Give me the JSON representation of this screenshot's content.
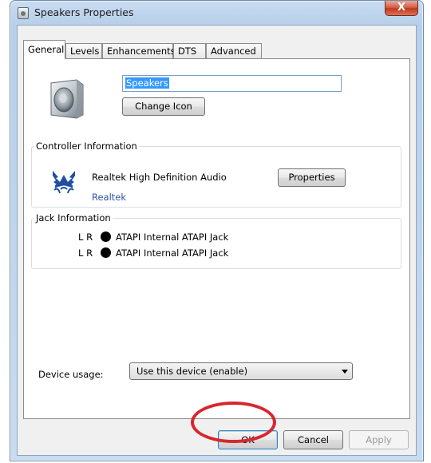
{
  "window": {
    "title": "Speakers Properties",
    "close_label": "X"
  },
  "tabs": [
    {
      "label": "General",
      "active": true
    },
    {
      "label": "Levels",
      "active": false
    },
    {
      "label": "Enhancements",
      "active": false
    },
    {
      "label": "DTS",
      "active": false
    },
    {
      "label": "Advanced",
      "active": false
    }
  ],
  "general": {
    "device_name": "Speakers",
    "change_icon_label": "Change Icon"
  },
  "controller": {
    "group_label": "Controller Information",
    "name": "Realtek High Definition Audio",
    "vendor_link": "Realtek",
    "properties_label": "Properties"
  },
  "jack": {
    "group_label": "Jack Information",
    "rows": [
      {
        "channels": "L R",
        "name": "ATAPI Internal ATAPI Jack"
      },
      {
        "channels": "L R",
        "name": "ATAPI Internal ATAPI Jack"
      }
    ]
  },
  "device_usage": {
    "label": "Device usage:",
    "selected": "Use this device (enable)"
  },
  "footer": {
    "ok_label": "OK",
    "cancel_label": "Cancel",
    "apply_label": "Apply",
    "apply_enabled": false
  },
  "colors": {
    "highlight_ring": "#d8262e",
    "link": "#2b55a8",
    "selection": "#3399ff"
  }
}
